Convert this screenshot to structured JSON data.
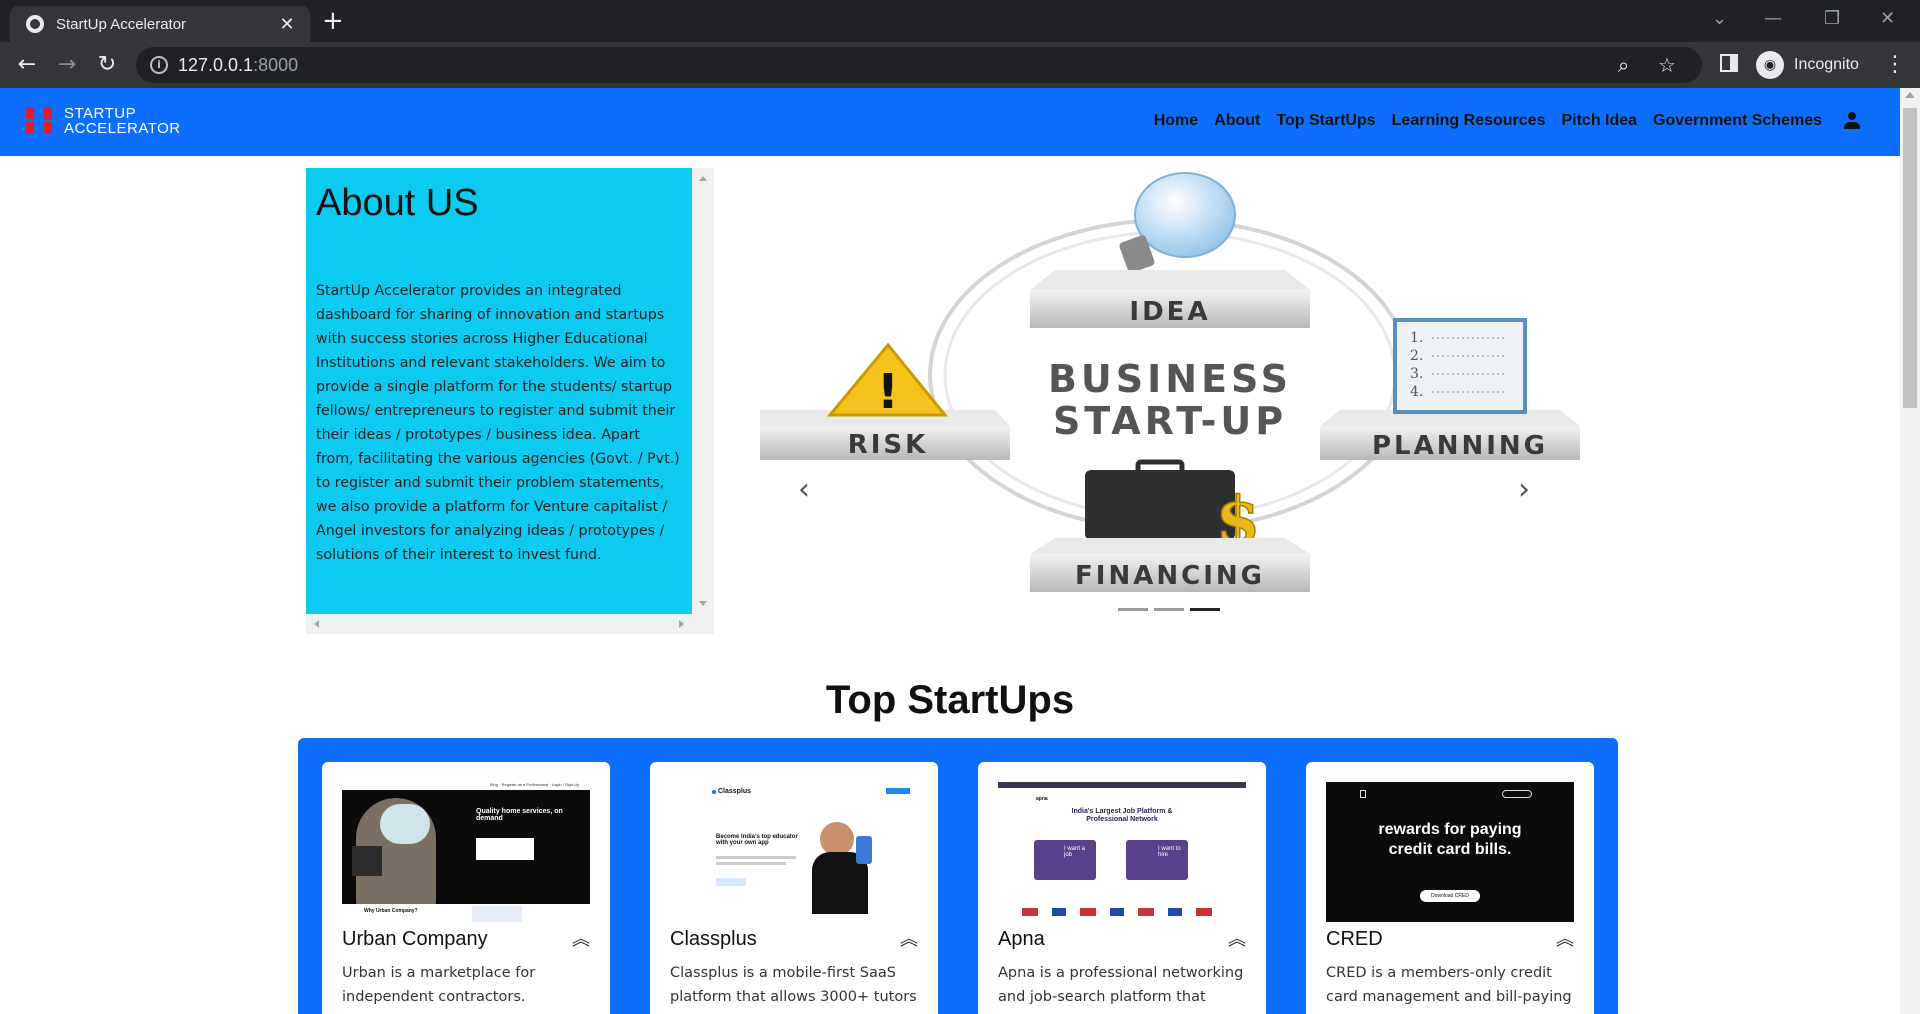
{
  "browser": {
    "tab_title": "StartUp Accelerator",
    "url_host": "127.0.0.1",
    "url_port": ":8000",
    "profile_label": "Incognito"
  },
  "navbar": {
    "logo_line1": "STARTUP",
    "logo_line2": "ACCELERATOR",
    "links": [
      "Home",
      "About",
      "Top StartUps",
      "Learning Resources",
      "Pitch Idea",
      "Government Schemes"
    ]
  },
  "about": {
    "title": "About US",
    "text": "StartUp Accelerator provides an integrated dashboard for sharing of innovation and startups with success stories across Higher Educational Institutions and relevant stakeholders. We aim to provide a single platform for the students/ startup fellows/ entrepreneurs to register and submit their their ideas / prototypes / business idea. Apart from, facilitating the various agencies (Govt. / Pvt.) to register and submit their problem statements, we also provide a platform for Venture capitalist / Angel investors for analyzing ideas / prototypes / solutions of their interest to invest fund."
  },
  "carousel": {
    "slide": {
      "label_idea": "IDEA",
      "label_risk": "RISK",
      "label_planning": "PLANNING",
      "label_financing": "FINANCING",
      "center_line1": "BUSINESS",
      "center_line2": "START-UP",
      "planning_list": [
        "1.",
        "2.",
        "3.",
        "4."
      ]
    },
    "indicator_count": 3,
    "active_indicator": 3
  },
  "top_startups": {
    "title": "Top StartUps",
    "cards": [
      {
        "name": "Urban Company",
        "description": "Urban is a marketplace for independent contractors.",
        "preview": {
          "headline": "Quality home services, on demand",
          "sub": "Why Urban Company?",
          "menu": [
            "Blog",
            "Register as a Professional",
            "Login / Sign Up"
          ]
        }
      },
      {
        "name": "Classplus",
        "description": "Classplus is a mobile-first SaaS platform that allows 3000+ tutors",
        "preview": {
          "logo": "Classplus",
          "headline": "Become India's top educator with your own app"
        }
      },
      {
        "name": "Apna",
        "description": "Apna is a professional networking and job-search platform that",
        "preview": {
          "logo": "apna",
          "headline": "India's Largest Job Platform & Professional Network",
          "btn_job": "I want a job",
          "btn_hire": "I want to hire"
        }
      },
      {
        "name": "CRED",
        "description": "CRED is a members-only credit card management and bill-paying",
        "preview": {
          "headline_line1": "rewards for paying",
          "headline_line2": "credit card bills.",
          "cta": "Download CRED"
        }
      }
    ]
  },
  "colors": {
    "navbar": "#0d6efd",
    "about_bg": "#0dcaf0",
    "cards_bg": "#0d6efd",
    "logo_mark": "#e5192c"
  },
  "icons": {
    "back": "arrow-left-icon",
    "forward": "arrow-right-icon",
    "reload": "reload-icon",
    "zoom": "zoom-icon",
    "bookmark": "star-icon",
    "user": "user-icon"
  }
}
